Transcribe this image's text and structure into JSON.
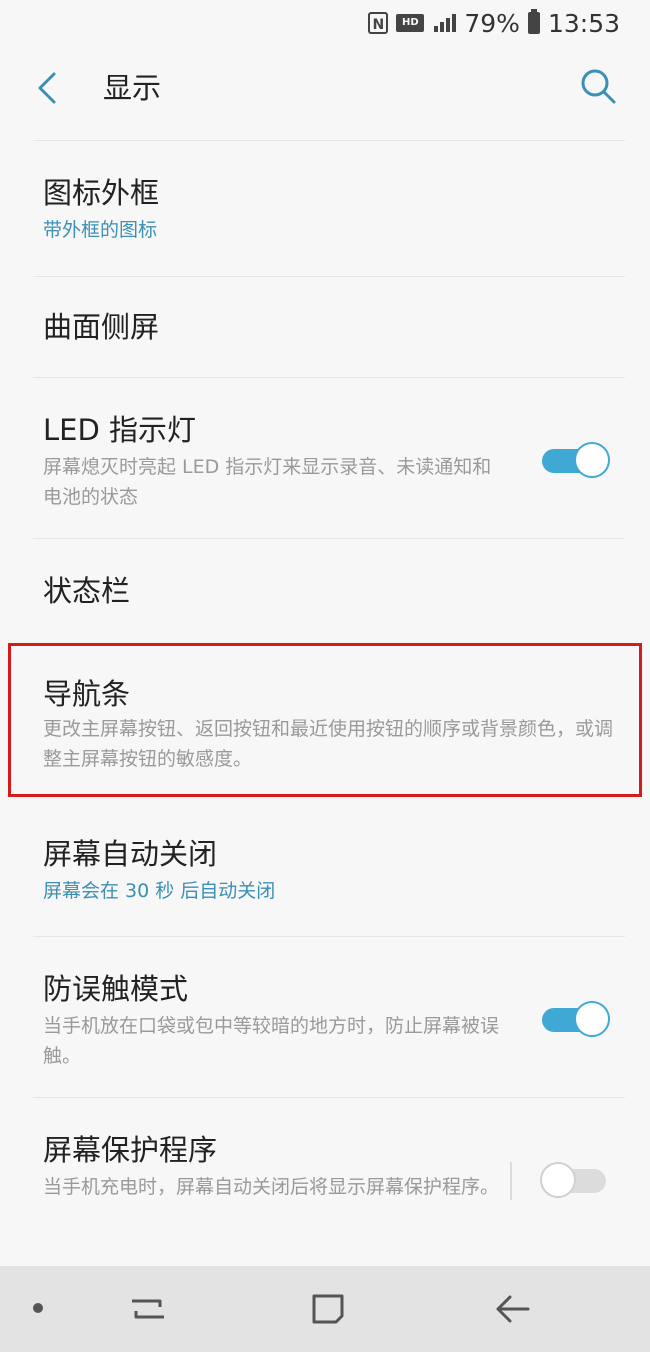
{
  "status_bar": {
    "battery": "79%",
    "time": "13:53",
    "icons": [
      "nfc-icon",
      "hd-icon",
      "signal-icon",
      "battery-icon"
    ]
  },
  "header": {
    "title": "显示",
    "back_icon": "back-arrow-icon",
    "search_icon": "search-icon"
  },
  "settings": {
    "items": [
      {
        "title": "图标外框",
        "subtitle": "带外框的图标"
      },
      {
        "title": "曲面侧屏"
      },
      {
        "title": "LED 指示灯",
        "subtitle": "屏幕熄灭时亮起 LED 指示灯来显示录音、未读通知和电池的状态",
        "toggle": true
      },
      {
        "title": "状态栏"
      },
      {
        "title": "导航条",
        "subtitle": "更改主屏幕按钮、返回按钮和最近使用按钮的顺序或背景颜色，或调整主屏幕按钮的敏感度。"
      },
      {
        "title": "屏幕自动关闭",
        "subtitle": "屏幕会在 30 秒 后自动关闭"
      },
      {
        "title": "防误触模式",
        "subtitle": "当手机放在口袋或包中等较暗的地方时，防止屏幕被误触。",
        "toggle": true
      },
      {
        "title": "屏幕保护程序",
        "subtitle": "当手机充电时，屏幕自动关闭后将显示屏幕保护程序。",
        "toggle": false
      }
    ]
  },
  "nav_bar": {
    "buttons": [
      "dot-icon",
      "recents-icon",
      "home-icon",
      "back-icon"
    ]
  },
  "colors": {
    "accent": "#3fa8d5",
    "subtitle_accent": "#3d8fb3",
    "highlight": "#d71a1a",
    "background": "#f7f7f7"
  }
}
